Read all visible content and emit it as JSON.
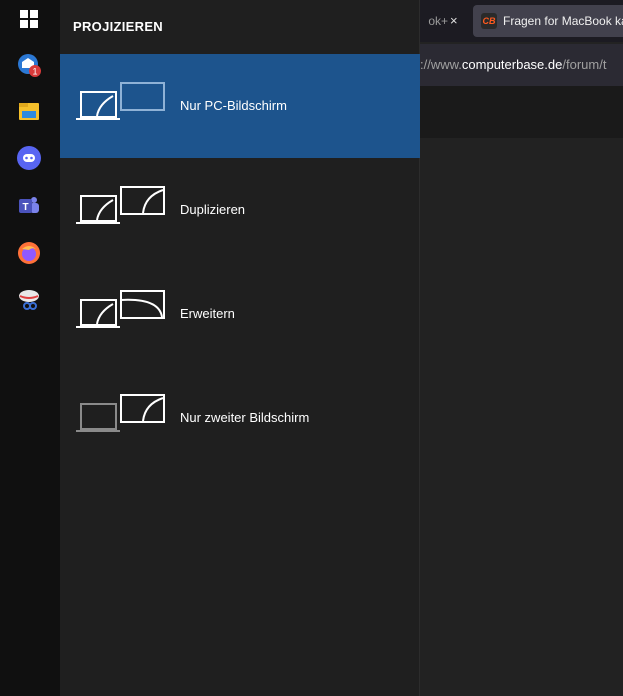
{
  "panel": {
    "title": "PROJIZIEREN",
    "options": [
      {
        "label": "Nur PC-Bildschirm",
        "icon": "pc-screen-only-icon",
        "selected": true
      },
      {
        "label": "Duplizieren",
        "icon": "duplicate-icon",
        "selected": false
      },
      {
        "label": "Erweitern",
        "icon": "extend-icon",
        "selected": false
      },
      {
        "label": "Nur zweiter Bildschirm",
        "icon": "second-screen-only-icon",
        "selected": false
      }
    ]
  },
  "taskbar": {
    "items": [
      {
        "icon": "windows-start-icon"
      },
      {
        "icon": "mail-icon",
        "badge": "1"
      },
      {
        "icon": "file-explorer-icon"
      },
      {
        "icon": "discord-icon"
      },
      {
        "icon": "teams-icon"
      },
      {
        "icon": "firefox-icon"
      },
      {
        "icon": "snipping-tool-icon"
      }
    ]
  },
  "browser": {
    "prev_tab_text": "ok+",
    "prev_tab_close": "×",
    "active_tab_favicon": "CB",
    "active_tab_title": "Fragen for MacBook ka",
    "url_prefix": "://www.",
    "url_host": "computerbase.de",
    "url_path": "/forum/t"
  },
  "colors": {
    "panel_bg": "#1f1f1f",
    "selected_bg": "#1d548d",
    "taskbar_bg": "#101010"
  }
}
